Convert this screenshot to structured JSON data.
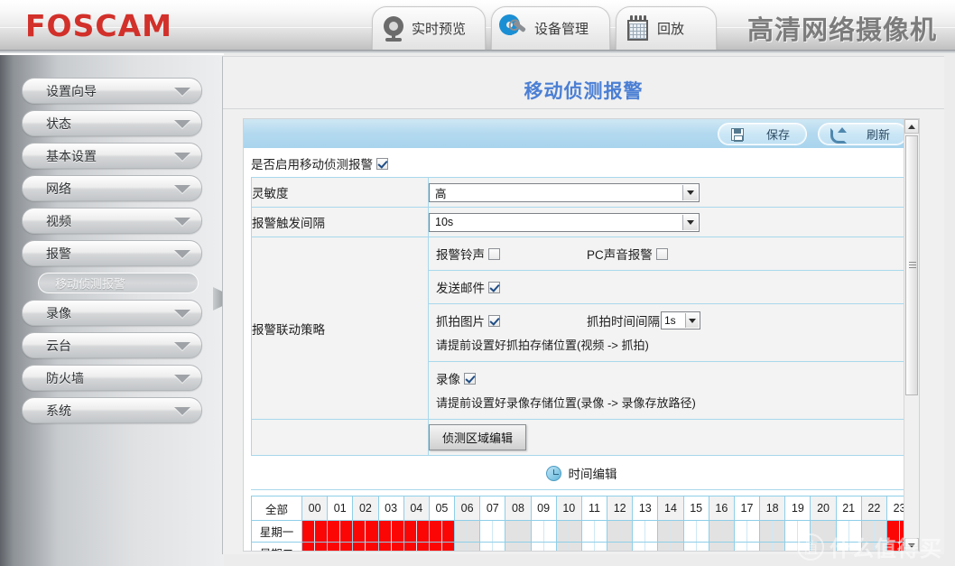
{
  "header": {
    "logo": "FOSCAM",
    "product_title": "高清网络摄像机",
    "tabs": [
      {
        "id": "live",
        "label": "实时预览",
        "icon": "camera-icon"
      },
      {
        "id": "device",
        "label": "设备管理",
        "icon": "gear-wrench-icon"
      },
      {
        "id": "play",
        "label": "回放",
        "icon": "calendar-icon"
      }
    ]
  },
  "sidebar": {
    "items": [
      {
        "label": "设置向导"
      },
      {
        "label": "状态"
      },
      {
        "label": "基本设置"
      },
      {
        "label": "网络"
      },
      {
        "label": "视频"
      },
      {
        "label": "报警"
      }
    ],
    "submenu": [
      {
        "label": "移动侦测报警",
        "active": true
      }
    ],
    "items_after": [
      {
        "label": "录像"
      },
      {
        "label": "云台"
      },
      {
        "label": "防火墙"
      },
      {
        "label": "系统"
      }
    ]
  },
  "main": {
    "page_title": "移动侦测报警",
    "toolbar": {
      "save_label": "保存",
      "refresh_label": "刷新"
    },
    "enable": {
      "label": "是否启用移动侦测报警",
      "checked": true
    },
    "rows": {
      "sensitivity_label": "灵敏度",
      "sensitivity_value": "高",
      "trigger_interval_label": "报警触发间隔",
      "trigger_interval_value": "10s",
      "linkage_label": "报警联动策略"
    },
    "linkage": {
      "ring_label": "报警铃声",
      "ring_checked": false,
      "pc_sound_label": "PC声音报警",
      "pc_sound_checked": false,
      "mail_label": "发送邮件",
      "mail_checked": true,
      "snapshot_label": "抓拍图片",
      "snapshot_checked": true,
      "snapshot_interval_label": "抓拍时间间隔",
      "snapshot_interval_value": "1s",
      "snapshot_hint": "请提前设置好抓拍存储位置(视频 -> 抓拍)",
      "record_label": "录像",
      "record_checked": true,
      "record_hint": "请提前设置好录像存储位置(录像 -> 录像存放路径)"
    },
    "detect_area_button": "侦测区域编辑",
    "time_edit": {
      "label": "时间编辑",
      "icon": "clock-icon"
    }
  },
  "schedule": {
    "all_label": "全部",
    "hours": [
      "00",
      "01",
      "02",
      "03",
      "04",
      "05",
      "06",
      "07",
      "08",
      "09",
      "10",
      "11",
      "12",
      "13",
      "14",
      "15",
      "16",
      "17",
      "18",
      "19",
      "20",
      "21",
      "22",
      "23"
    ],
    "days": [
      {
        "label": "星期一",
        "half_hours": [
          true,
          true,
          true,
          true,
          true,
          true,
          true,
          true,
          true,
          true,
          true,
          true,
          false,
          false,
          false,
          false,
          false,
          false,
          false,
          false,
          false,
          false,
          false,
          false,
          false,
          false,
          false,
          false,
          false,
          false,
          false,
          false,
          false,
          false,
          false,
          false,
          false,
          false,
          false,
          false,
          false,
          false,
          false,
          false,
          false,
          false,
          true,
          true
        ]
      },
      {
        "label": "星期二",
        "half_hours": [
          true,
          true,
          true,
          true,
          true,
          true,
          true,
          true,
          true,
          true,
          true,
          true,
          false,
          false,
          false,
          false,
          false,
          false,
          false,
          false,
          false,
          false,
          false,
          false,
          false,
          false,
          false,
          false,
          false,
          false,
          false,
          false,
          false,
          false,
          false,
          false,
          false,
          false,
          false,
          false,
          false,
          false,
          false,
          false,
          false,
          false,
          true,
          true
        ]
      }
    ]
  },
  "scrollbar": {
    "up_icon": "chevron-up-icon",
    "down_icon": "chevron-down-icon"
  },
  "watermark": {
    "mark": "值",
    "text": "什么值得买"
  },
  "colors": {
    "brand_red": "#d2302a",
    "title_blue": "#4b7fd4",
    "toolbar_blue": "#b3d9ef",
    "grid_red": "#fb0505",
    "grid_border": "#8fcfe8"
  }
}
